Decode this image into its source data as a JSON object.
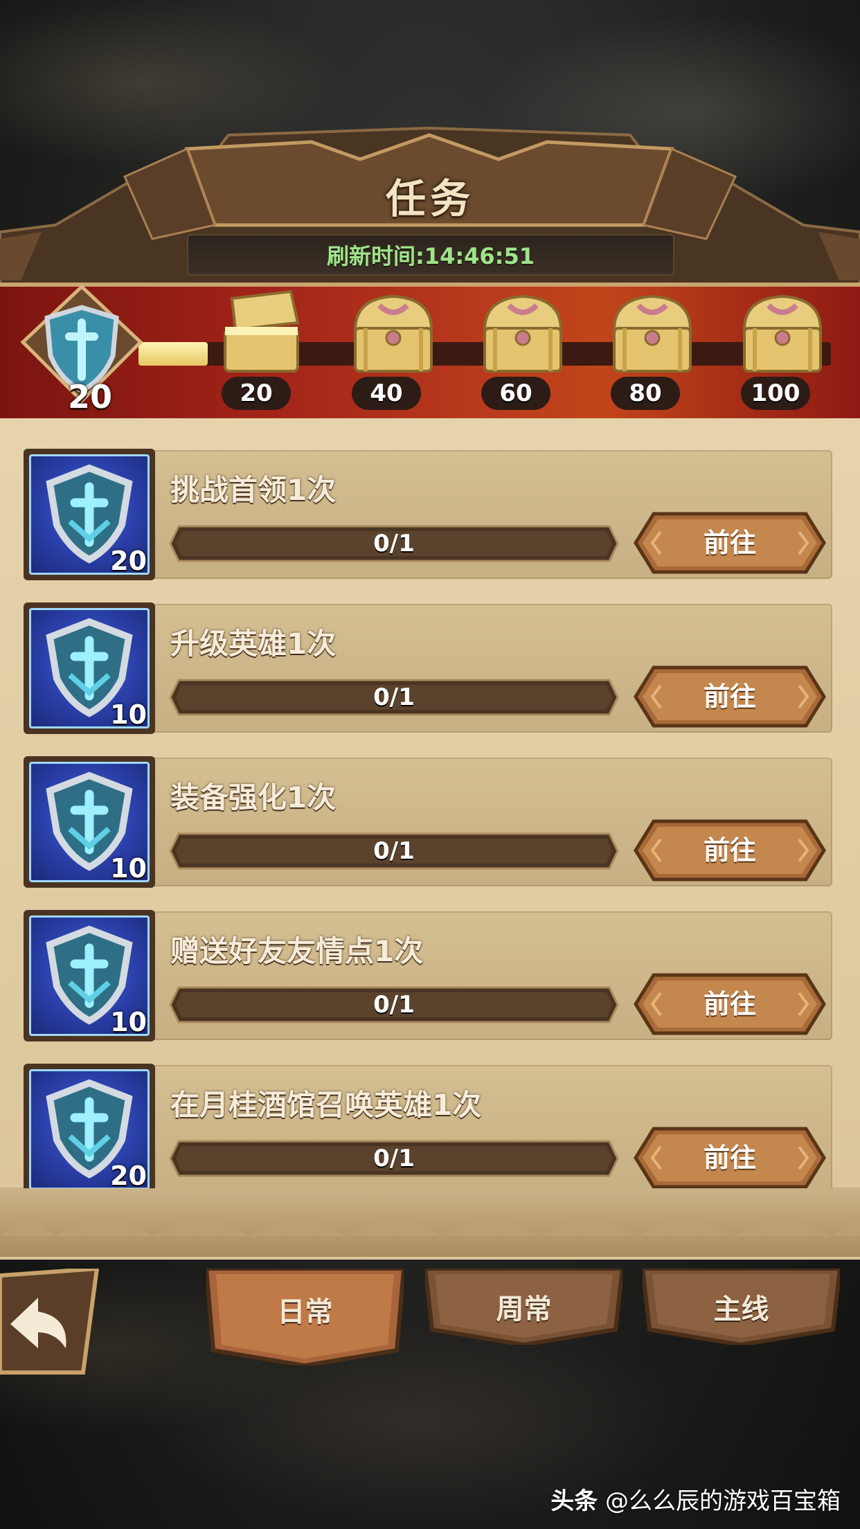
{
  "header": {
    "title": "任务",
    "refresh_label": "刷新时间:14:46:51"
  },
  "rewards": {
    "current_points": "20",
    "progress_fraction": 0.1,
    "chests": [
      {
        "label": "20",
        "opened": true
      },
      {
        "label": "40",
        "opened": false
      },
      {
        "label": "60",
        "opened": false
      },
      {
        "label": "80",
        "opened": false
      },
      {
        "label": "100",
        "opened": false
      }
    ]
  },
  "tasks": [
    {
      "name": "挑战首领1次",
      "reward": "20",
      "progress": "0/1",
      "button": "前往"
    },
    {
      "name": "升级英雄1次",
      "reward": "10",
      "progress": "0/1",
      "button": "前往"
    },
    {
      "name": "装备强化1次",
      "reward": "10",
      "progress": "0/1",
      "button": "前往"
    },
    {
      "name": "赠送好友友情点1次",
      "reward": "10",
      "progress": "0/1",
      "button": "前往"
    },
    {
      "name": "在月桂酒馆召唤英雄1次",
      "reward": "20",
      "progress": "0/1",
      "button": "前往"
    }
  ],
  "tabs": [
    {
      "label": "日常",
      "active": true
    },
    {
      "label": "周常",
      "active": false
    },
    {
      "label": "主线",
      "active": false
    }
  ],
  "watermark": {
    "brand": "头条",
    "text": "@么么辰的游戏百宝箱"
  },
  "colors": {
    "refresh_text": "#9fe48a",
    "strip_red": "#a12318",
    "panel_tan": "#e6d3ac",
    "button_brown": "#a86a38"
  },
  "icons": {
    "task_reward": "shield-cross-icon",
    "chest": "treasure-chest-icon",
    "back": "back-arrow-icon"
  }
}
